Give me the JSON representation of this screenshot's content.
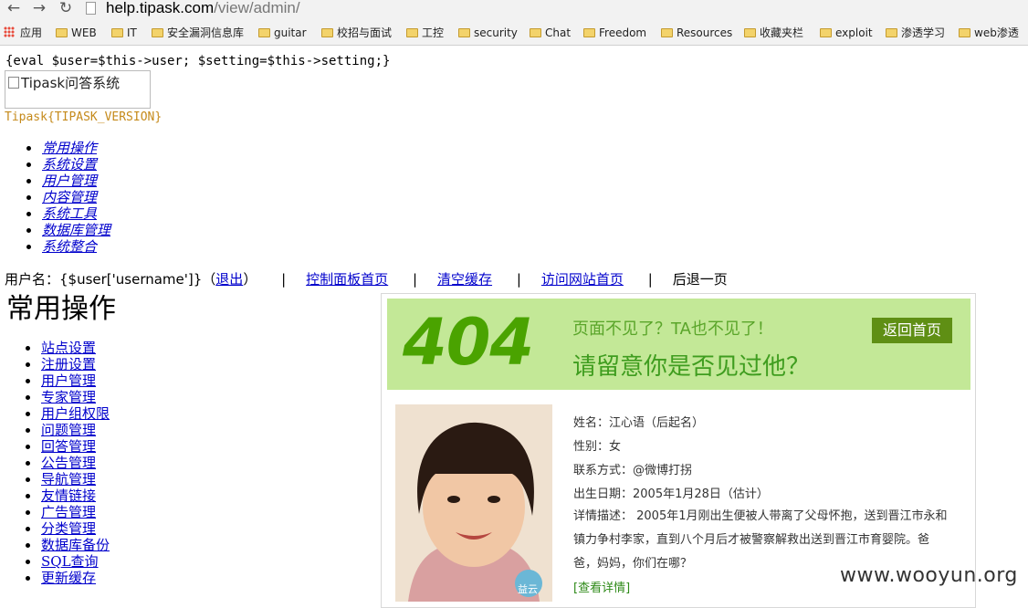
{
  "browser": {
    "nav": {
      "back": "←",
      "forward": "→",
      "reload": "↻"
    },
    "url_host": "help.tipask.com",
    "url_path": "/view/admin/",
    "bookmarks": [
      {
        "label": "应用",
        "type": "apps"
      },
      {
        "label": "WEB",
        "type": "folder"
      },
      {
        "label": "IT",
        "type": "folder"
      },
      {
        "label": "安全漏洞信息库",
        "type": "folder"
      },
      {
        "label": "guitar",
        "type": "folder"
      },
      {
        "label": "校招与面试",
        "type": "folder"
      },
      {
        "label": "工控",
        "type": "folder"
      },
      {
        "label": "security",
        "type": "folder"
      },
      {
        "label": "Chat",
        "type": "folder"
      },
      {
        "label": "Freedom",
        "type": "folder"
      },
      {
        "label": "Resources",
        "type": "folder"
      },
      {
        "label": "收藏夹栏",
        "type": "folder"
      },
      {
        "label": "exploit",
        "type": "folder"
      },
      {
        "label": "渗透学习",
        "type": "folder"
      },
      {
        "label": "web渗透",
        "type": "folder"
      }
    ]
  },
  "page": {
    "eval_line": "{eval $user=$this->user; $setting=$this->setting;}",
    "logo_alt": "Tipask问答系统",
    "version": "Tipask{TIPASK_VERSION}",
    "menu": [
      "常用操作",
      "系统设置",
      "用户管理",
      "内容管理",
      "系统工具",
      "数据库管理",
      "系统整合"
    ],
    "userbar": {
      "prefix": "用户名：{$user['username']}（",
      "logout": "退出",
      "suffix": "）",
      "separator": "|",
      "links": [
        "控制面板首页",
        "清空缓存",
        "访问网站首页"
      ],
      "back": "后退一页"
    },
    "heading": "常用操作",
    "operations": [
      "站点设置",
      "注册设置",
      "用户管理",
      "专家管理",
      "用户组权限",
      "问题管理",
      "回答管理",
      "公告管理",
      "导航管理",
      "友情链接",
      "广告管理",
      "分类管理",
      "数据库备份",
      "SQL查询",
      "更新缓存"
    ]
  },
  "notfound": {
    "code": "404",
    "msg1": "页面不见了？TA也不见了！",
    "msg2": "请留意你是否见过他？",
    "home_button": "返回首页",
    "info": {
      "name": "姓名：江心语（后起名）",
      "gender": "性别：女",
      "contact": "联系方式：@微博打拐",
      "birth": "出生日期：2005年1月28日（估计）",
      "desc": "详情描述： 2005年1月刚出生便被人带离了父母怀抱，送到晋江市永和镇力争村李家，直到八个月后才被警察解救出送到晋江市育婴院。爸爸，妈妈，你们在哪？",
      "detail_link": "[查看详情]"
    },
    "photo_stamp": "益云"
  },
  "watermark": "www.wooyun.org",
  "colors": {
    "banner": "#c3e897",
    "accent_green": "#4aa300",
    "button": "#5f8f14",
    "link": "#0000cc",
    "version": "#c58a1b"
  }
}
